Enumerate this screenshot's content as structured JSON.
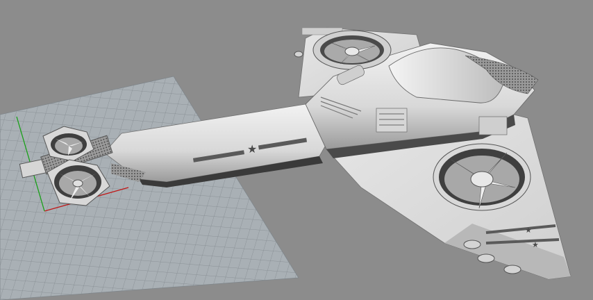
{
  "viewport": {
    "background_color": "#8c8c8c",
    "grid_color": "#a9b0b5",
    "grid_line_color": "#7f868b",
    "x_axis_color": "#c01818",
    "y_axis_color": "#18a018",
    "model_light": "#e8e8e8",
    "model_mid": "#c4c4c4",
    "model_dark": "#4a4a4a",
    "stripe_color": "#5a5a5a",
    "model_icons": [
      "star-insignia-icon",
      "rotor-fan-icon"
    ]
  }
}
